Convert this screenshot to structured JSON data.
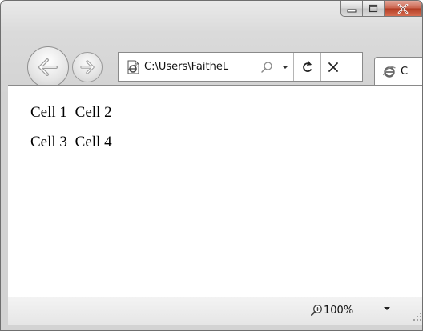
{
  "window": {
    "caption_buttons": [
      "minimize-icon",
      "maximize-icon",
      "close-icon"
    ]
  },
  "navigation": {
    "back_icon": "back-arrow-icon",
    "forward_icon": "forward-arrow-icon"
  },
  "address_bar": {
    "value": "C:\\Users\\FaitheL",
    "icons": [
      "ie-page-icon",
      "search-icon",
      "dropdown-arrow-icon",
      "refresh-icon",
      "stop-icon"
    ]
  },
  "tab": {
    "label": "C",
    "icon": "ie-logo-icon"
  },
  "content": {
    "rows": [
      {
        "cells": [
          "Cell 1",
          "Cell 2"
        ]
      },
      {
        "cells": [
          "Cell 3",
          "Cell 4"
        ]
      }
    ]
  },
  "status_bar": {
    "zoom": "100%",
    "icons": [
      "zoom-icon",
      "zoom-dropdown-icon",
      "resize-grip-icon"
    ]
  },
  "colors": {
    "frame": "#d6d6d6",
    "close_button": "#c24a32",
    "content_bg": "#ffffff"
  }
}
